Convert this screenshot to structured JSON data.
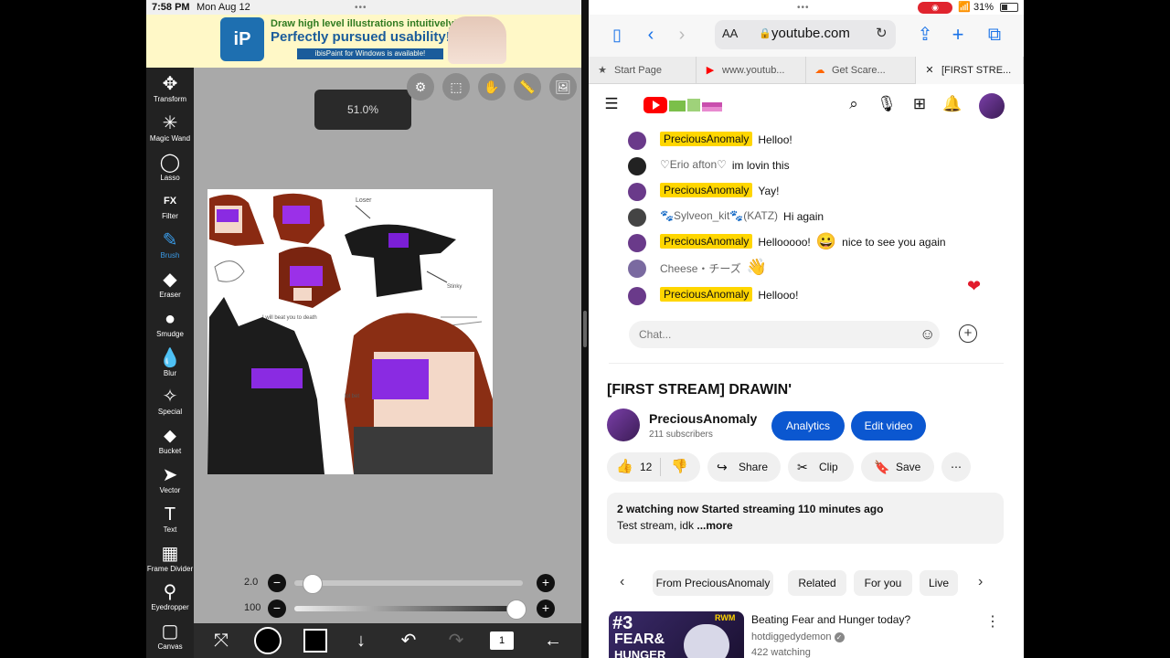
{
  "status_left": {
    "time": "7:58 PM",
    "date": "Mon Aug 12"
  },
  "status_right": {
    "battery": "31%"
  },
  "ad": {
    "line1": "Draw high level illustrations intuitively!",
    "line2": "Perfectly pursued usability!",
    "line3": "ibisPaint for Windows is available!"
  },
  "ibis": {
    "tools": [
      {
        "label": "Transform",
        "icon": "move-icon",
        "glyph": "✥"
      },
      {
        "label": "Magic Wand",
        "icon": "magic-wand-icon",
        "glyph": "✳"
      },
      {
        "label": "Lasso",
        "icon": "lasso-icon",
        "glyph": "◯"
      },
      {
        "label": "Filter",
        "icon": "filter-icon",
        "glyph": "FX"
      },
      {
        "label": "Brush",
        "icon": "brush-icon",
        "glyph": "✎"
      },
      {
        "label": "Eraser",
        "icon": "eraser-icon",
        "glyph": "◆"
      },
      {
        "label": "Smudge",
        "icon": "smudge-icon",
        "glyph": "●"
      },
      {
        "label": "Blur",
        "icon": "blur-icon",
        "glyph": "💧"
      },
      {
        "label": "Special",
        "icon": "special-pen-icon",
        "glyph": "✧"
      },
      {
        "label": "Bucket",
        "icon": "bucket-icon",
        "glyph": "⬥"
      },
      {
        "label": "Vector",
        "icon": "vector-cursor-icon",
        "glyph": "➤"
      },
      {
        "label": "Text",
        "icon": "text-icon",
        "glyph": "T"
      },
      {
        "label": "Frame Divider",
        "icon": "frame-divider-icon",
        "glyph": "▦"
      },
      {
        "label": "Eyedropper",
        "icon": "eyedropper-icon",
        "glyph": "⚲"
      },
      {
        "label": "Canvas",
        "icon": "canvas-icon",
        "glyph": "▢"
      }
    ],
    "active_tool": "Brush",
    "zoom": "51.0%",
    "brush_size": "2.0",
    "brush_size_fraction": 0.05,
    "opacity": "100",
    "opacity_fraction": 1.0,
    "layer_count": "1",
    "art_labels": {
      "loser": "Loser",
      "stinky": "Stinky",
      "kill": "I will beat you to death",
      "lol": "lol bet"
    }
  },
  "safari": {
    "url": "youtube.com",
    "aa": "AA",
    "tabs": [
      {
        "label": "Start Page",
        "icon": "star-icon"
      },
      {
        "label": "www.youtub...",
        "icon": "youtube-icon"
      },
      {
        "label": "Get Scare...",
        "icon": "soundcloud-icon"
      },
      {
        "label": "[FIRST STRE...",
        "icon": "close-icon"
      }
    ]
  },
  "chat": {
    "messages": [
      {
        "author": "PreciousAnomaly",
        "owner": true,
        "text": "Helloo!",
        "emoji": ""
      },
      {
        "author": "♡Erio afton♡",
        "owner": false,
        "text": "im lovin this",
        "emoji": ""
      },
      {
        "author": "PreciousAnomaly",
        "owner": true,
        "text": "Yay!",
        "emoji": ""
      },
      {
        "author": "🐾Sylveon_kit🐾(KATZ)",
        "owner": false,
        "text": "Hi again",
        "emoji": ""
      },
      {
        "author": "PreciousAnomaly",
        "owner": true,
        "text": "Hellooooo!",
        "emoji": "😀",
        "text2": "nice to see you again"
      },
      {
        "author": "Cheese・チーズ",
        "owner": false,
        "text": "",
        "emoji": "👋"
      },
      {
        "author": "PreciousAnomaly",
        "owner": true,
        "text": "Hellooo!",
        "emoji": ""
      }
    ],
    "placeholder": "Chat..."
  },
  "video": {
    "title": "[FIRST STREAM] DRAWIN'",
    "channel": "PreciousAnomaly",
    "subscribers": "211 subscribers",
    "analytics": "Analytics",
    "edit_video": "Edit video",
    "likes": "12",
    "share": "Share",
    "clip": "Clip",
    "save": "Save",
    "watching_line": "2 watching now  Started streaming 110 minutes ago",
    "desc": "Test stream, idk",
    "more": "...more"
  },
  "chips": [
    "From PreciousAnomaly",
    "Related",
    "For you",
    "Live"
  ],
  "recommended": {
    "title": "Beating Fear and Hunger today?",
    "channel": "hotdiggedydemon",
    "watching": "422 watching",
    "thumb_text1": "#3",
    "thumb_text2": "FEAR&",
    "thumb_text3": "HUNGER",
    "badge": "RWM"
  },
  "colors": {
    "yt_red": "#ff0000",
    "owner_badge": "#ffd600",
    "brush_blue": "#3a9be8",
    "button_blue": "#0b57d0",
    "heart": "#e21b2c"
  }
}
